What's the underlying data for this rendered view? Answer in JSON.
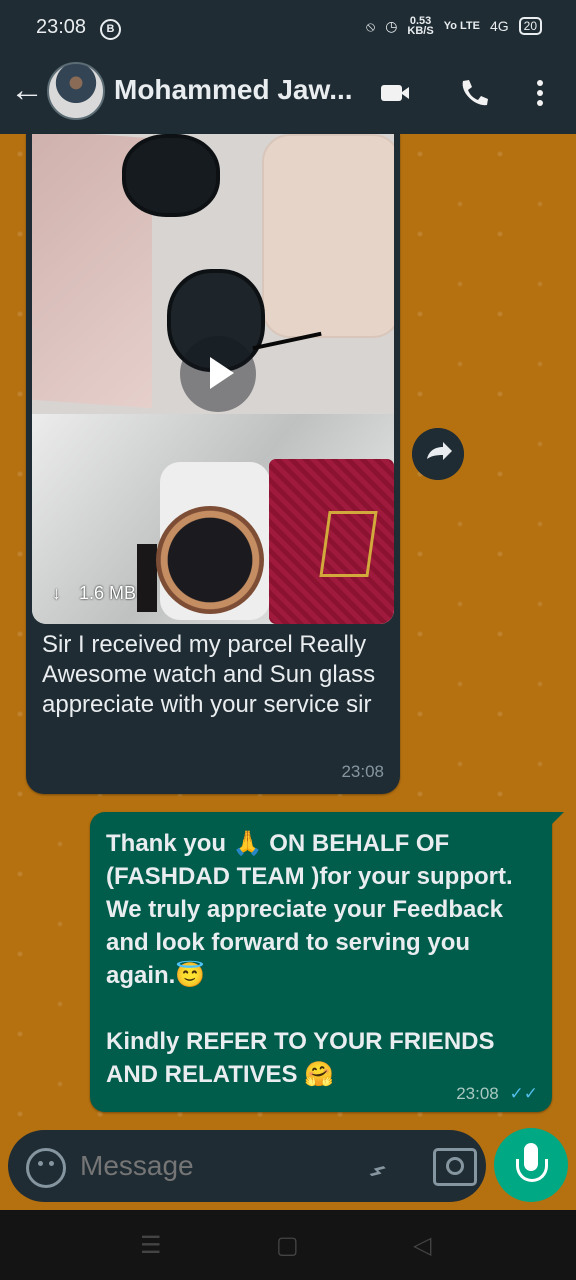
{
  "status": {
    "time": "23:08",
    "badge": "B",
    "speed_top": "0.53",
    "speed_bottom": "KB/S",
    "network": "Yo LTE",
    "signal": "4G",
    "battery": "20"
  },
  "header": {
    "contact_name": "Mohammed Jaw..."
  },
  "icons": {
    "back": "arrow-left-icon",
    "video": "video-icon",
    "call": "phone-icon",
    "more": "more-vertical-icon",
    "forward": "forward-icon",
    "emoji": "emoji-icon",
    "attach": "paperclip-icon",
    "camera": "camera-icon",
    "microphone": "microphone-icon"
  },
  "incoming": {
    "media_size": "1.6 MB",
    "text": "Sir I received my parcel Really Awesome watch and Sun glass\nappreciate with your service sir",
    "time": "23:08"
  },
  "outgoing": {
    "text": "Thank you 🙏 ON BEHALF OF (FASHDAD TEAM )for your support. We truly appreciate your Feedback and look forward to serving you again.😇\n\nKindly REFER TO YOUR FRIENDS AND RELATIVES 🤗",
    "time": "23:08"
  },
  "composer": {
    "placeholder": "Message"
  }
}
